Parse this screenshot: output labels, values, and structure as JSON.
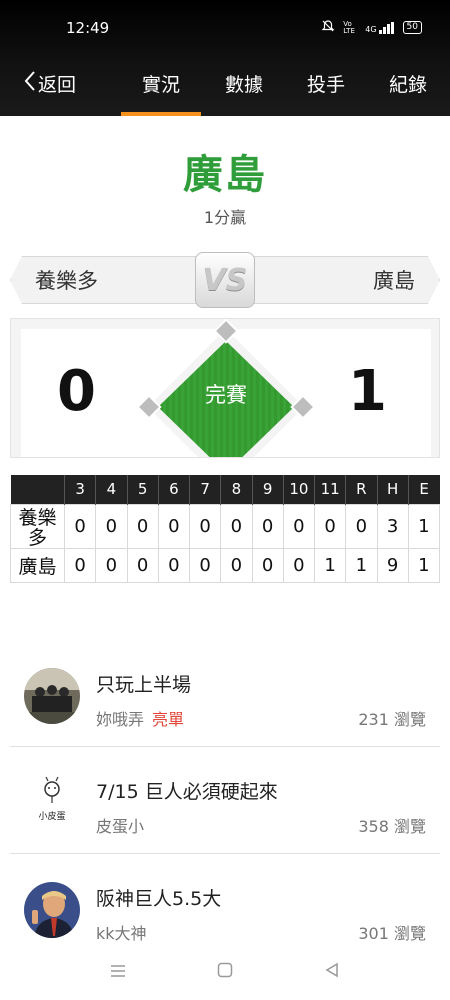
{
  "status_bar": {
    "time": "12:49",
    "icons": [
      "mute-icon",
      "volte-icon",
      "4g-signal-icon",
      "battery-icon"
    ],
    "volte_label": "Vo LTE",
    "network_label": "4G",
    "battery": "50"
  },
  "nav": {
    "back_label": "返回",
    "tabs": [
      {
        "label": "實況",
        "active": true
      },
      {
        "label": "數據",
        "active": false
      },
      {
        "label": "投手",
        "active": false
      },
      {
        "label": "紀錄",
        "active": false
      }
    ],
    "accent": "#f5921e"
  },
  "game": {
    "winner": "廣島",
    "winner_color": "#2f9e3a",
    "margin": "1分贏",
    "away_team": "養樂多",
    "home_team": "廣島",
    "vs_label": "VS",
    "away_score": "0",
    "home_score": "1",
    "status": "完賽"
  },
  "linescore": {
    "headers": [
      "",
      "3",
      "4",
      "5",
      "6",
      "7",
      "8",
      "9",
      "10",
      "11",
      "R",
      "H",
      "E"
    ],
    "rows": [
      {
        "team": "養樂多",
        "cells": [
          "0",
          "0",
          "0",
          "0",
          "0",
          "0",
          "0",
          "0",
          "0",
          "0",
          "3",
          "1"
        ]
      },
      {
        "team": "廣島",
        "cells": [
          "0",
          "0",
          "0",
          "0",
          "0",
          "0",
          "0",
          "0",
          "1",
          "1",
          "9",
          "1"
        ]
      }
    ]
  },
  "articles": [
    {
      "title": "只玩上半場",
      "author": "妳哦弄",
      "tag": "亮單",
      "views": "231 瀏覽",
      "avatar": "group-photo-avatar"
    },
    {
      "title": "7/15 巨人必須硬起來",
      "author": "皮蛋小",
      "tag": "",
      "views": "358 瀏覽",
      "avatar": "cartoon-avatar",
      "avatar_text": "小皮蛋"
    },
    {
      "title": "阪神巨人5.5大",
      "author": "kk大神",
      "tag": "",
      "views": "301 瀏覽",
      "avatar": "portrait-avatar"
    }
  ],
  "system_nav": {
    "icons": [
      "menu-icon",
      "home-icon",
      "back-icon"
    ]
  }
}
